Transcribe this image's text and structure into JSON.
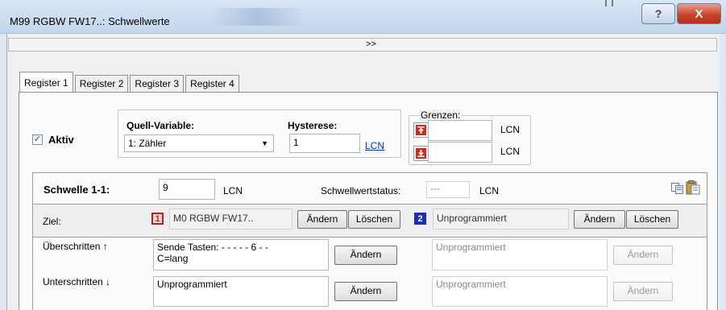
{
  "window": {
    "title": "M99 RGBW FW17..: Schwellwerte",
    "help_label": "?",
    "close_label": "X"
  },
  "expander": {
    "label": ">>"
  },
  "tabs": [
    {
      "label": "Register 1",
      "active": true
    },
    {
      "label": "Register 2",
      "active": false
    },
    {
      "label": "Register 3",
      "active": false
    },
    {
      "label": "Register 4",
      "active": false
    }
  ],
  "aktiv": {
    "label": "Aktiv",
    "checked": true
  },
  "source": {
    "label": "Quell-Variable:",
    "selected": "1: Zähler"
  },
  "hysteresis": {
    "label": "Hysterese:",
    "value": "1",
    "unit": "LCN"
  },
  "limits": {
    "label": "Grenzen:",
    "upper_unit": "LCN",
    "lower_unit": "LCN",
    "upper_value": "",
    "lower_value": ""
  },
  "threshold": {
    "label": "Schwelle 1-1:",
    "value": "9",
    "unit": "LCN",
    "status_label": "Schwellwertstatus:",
    "status_value": "---",
    "status_unit": "LCN"
  },
  "target": {
    "label": "Ziel:",
    "slot1": {
      "badge": "1",
      "value": "M0 RGBW FW17..",
      "change": "Ändern",
      "delete": "Löschen"
    },
    "slot2": {
      "badge": "2",
      "value": "Unprogrammiert",
      "change": "Ändern",
      "delete": "Löschen"
    }
  },
  "exceeded": {
    "label": "Überschritten ↑",
    "cmd1": "Sende Tasten: - - - - - 6 - -\nC=lang",
    "change1": "Ändern",
    "cmd2": "Unprogrammiert",
    "change2": "Ändern"
  },
  "undercut": {
    "label": "Unterschritten ↓",
    "cmd1": "Unprogrammiert",
    "change1": "Ändern",
    "cmd2": "Unprogrammiert",
    "change2": "Ändern"
  },
  "colors": {
    "badge1": "#b22222",
    "badge2": "#1a2fb0",
    "link": "#0033cc",
    "close": "#c8452b"
  }
}
